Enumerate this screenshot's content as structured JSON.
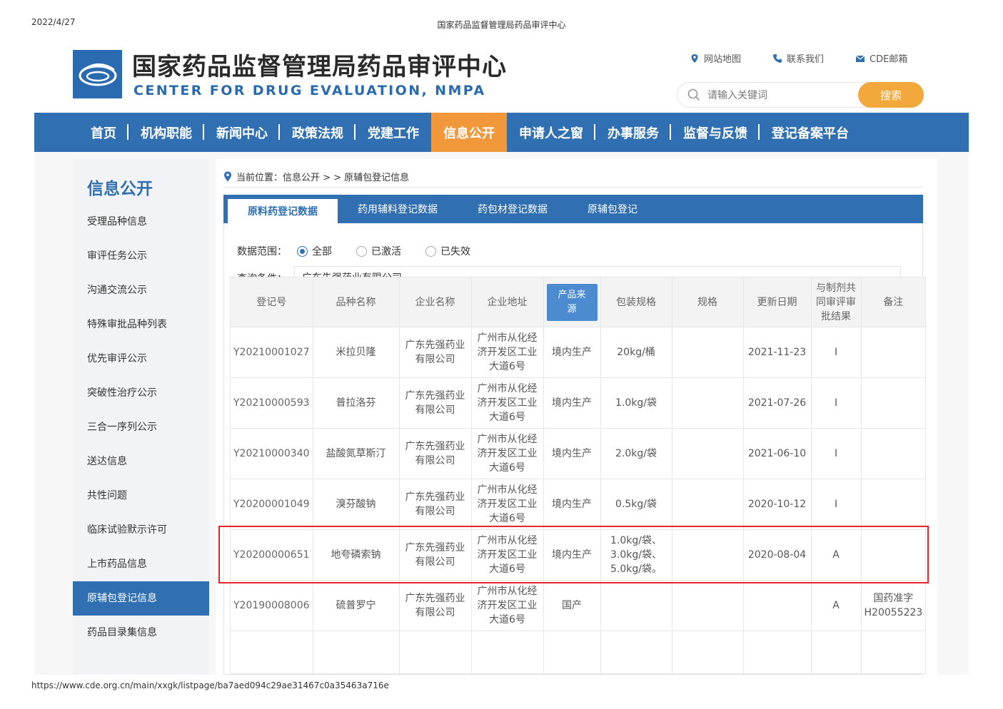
{
  "print": {
    "date": "2022/4/27",
    "title": "国家药品监督管理局药品审评中心",
    "url": "https://www.cde.org.cn/main/xxgk/listpage/ba7aed094c29ae31467c0a35463a716e"
  },
  "header": {
    "site_name_cn": "国家药品监督管理局药品审评中心",
    "site_name_en": "CENTER FOR DRUG EVALUATION, NMPA",
    "links": [
      {
        "label": "网站地图",
        "icon": "location-pin-icon"
      },
      {
        "label": "联系我们",
        "icon": "phone-icon"
      },
      {
        "label": "CDE邮箱",
        "icon": "mail-icon"
      }
    ],
    "search": {
      "placeholder": "请输入关键词",
      "button": "搜索"
    },
    "brand_color": "#2f6fb2",
    "accent_color": "#f0983a"
  },
  "nav": {
    "items": [
      "首页",
      "机构职能",
      "新闻中心",
      "政策法规",
      "党建工作",
      "信息公开",
      "申请人之窗",
      "办事服务",
      "监督与反馈",
      "登记备案平台"
    ],
    "active_index": 5
  },
  "sidebar": {
    "title": "信息公开",
    "items": [
      "受理品种信息",
      "审评任务公示",
      "沟通交流公示",
      "特殊审批品种列表",
      "优先审评公示",
      "突破性治疗公示",
      "三合一序列公示",
      "送达信息",
      "共性问题",
      "临床试验默示许可",
      "上市药品信息",
      "原辅包登记信息",
      "药品目录集信息"
    ],
    "active_index": 11
  },
  "breadcrumb": {
    "label": "当前位置：信息公开 > > 原辅包登记信息"
  },
  "tabs": {
    "items": [
      "原料药登记数据",
      "药用辅料登记数据",
      "药包材登记数据",
      "原辅包登记"
    ],
    "active_index": 0
  },
  "filter": {
    "range_label": "数据范围：",
    "options": [
      "全部",
      "已激活",
      "已失效"
    ],
    "selected_index": 0,
    "query_label": "查询条件：",
    "query_value": "广东先强药业有限公司"
  },
  "table": {
    "columns": [
      "登记号",
      "品种名称",
      "企业名称",
      "企业地址",
      "产品来源",
      "包装规格",
      "规格",
      "更新日期",
      "与制剂共同审评审批结果",
      "备注"
    ],
    "rows": [
      {
        "id": "Y20210001027",
        "name": "米拉贝隆",
        "company": "广东先强药业有限公司",
        "address": "广州市从化经济开发区工业大道6号",
        "source": "境内生产",
        "package": "20kg/桶",
        "spec": "",
        "date": "2021-11-23",
        "result": "I",
        "note": ""
      },
      {
        "id": "Y20210000593",
        "name": "普拉洛芬",
        "company": "广东先强药业有限公司",
        "address": "广州市从化经济开发区工业大道6号",
        "source": "境内生产",
        "package": "1.0kg/袋",
        "spec": "",
        "date": "2021-07-26",
        "result": "I",
        "note": ""
      },
      {
        "id": "Y20210000340",
        "name": "盐酸氮草斯汀",
        "company": "广东先强药业有限公司",
        "address": "广州市从化经济开发区工业大道6号",
        "source": "境内生产",
        "package": "2.0kg/袋",
        "spec": "",
        "date": "2021-06-10",
        "result": "I",
        "note": ""
      },
      {
        "id": "Y20200001049",
        "name": "溴芬酸钠",
        "company": "广东先强药业有限公司",
        "address": "广州市从化经济开发区工业大道6号",
        "source": "境内生产",
        "package": "0.5kg/袋",
        "spec": "",
        "date": "2020-10-12",
        "result": "I",
        "note": ""
      },
      {
        "id": "Y20200000651",
        "name": "地夸磷索钠",
        "company": "广东先强药业有限公司",
        "address": "广州市从化经济开发区工业大道6号",
        "source": "境内生产",
        "package": "1.0kg/袋、3.0kg/袋、5.0kg/袋。",
        "spec": "",
        "date": "2020-08-04",
        "result": "A",
        "note": ""
      },
      {
        "id": "Y20190008006",
        "name": "硫普罗宁",
        "company": "广东先强药业有限公司",
        "address": "广州市从化经济开发区工业大道6号",
        "source": "国产",
        "package": "",
        "spec": "",
        "date": "",
        "result": "A",
        "note": "国药准字H20055223"
      }
    ],
    "highlight_row_index": 4,
    "highlight_color": "#e5252a"
  }
}
